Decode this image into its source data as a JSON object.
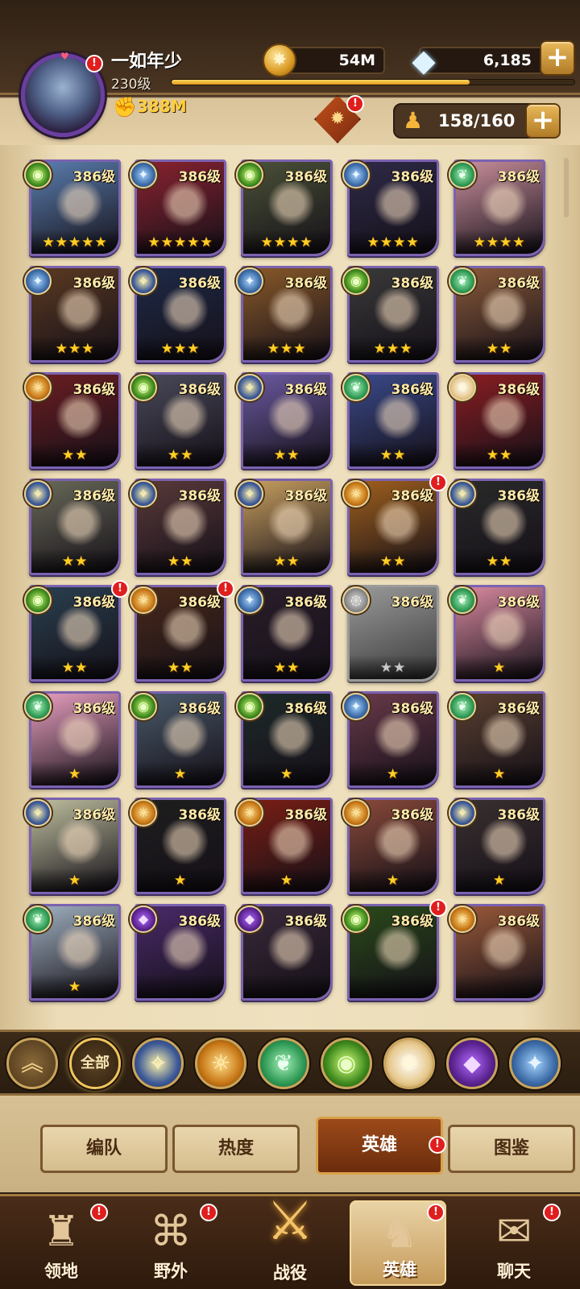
{
  "header": {
    "player_name": "一如年少",
    "player_level": "230级",
    "combat_power": "388M",
    "gold": "54M",
    "gems": "6,185",
    "hero_count": "158/160",
    "exp_progress": 0.74,
    "icons": {
      "avatar": "avatar-portrait",
      "power": "fist-icon",
      "gold": "gold-coin-icon",
      "gem": "diamond-icon",
      "chest": "reward-chest-icon",
      "hero_count": "person-icon",
      "add": "plus-icon"
    }
  },
  "heroes": [
    {
      "level": "386级",
      "stars": "★★★★★",
      "faction": "f-wild",
      "glyph": "◉",
      "color": "#5b7fb0",
      "alert": false,
      "grey": false
    },
    {
      "level": "386级",
      "stars": "★★★★★",
      "faction": "f-tech",
      "glyph": "✦",
      "color": "#8a2330",
      "alert": false,
      "grey": false
    },
    {
      "level": "386级",
      "stars": "★★★★",
      "faction": "f-wild",
      "glyph": "◉",
      "color": "#4a5238",
      "alert": false,
      "grey": false
    },
    {
      "level": "386级",
      "stars": "★★★★",
      "faction": "f-tech",
      "glyph": "✦",
      "color": "#2e2a48",
      "alert": false,
      "grey": false
    },
    {
      "level": "386级",
      "stars": "★★★★",
      "faction": "f-nature",
      "glyph": "❦",
      "color": "#c98f9c",
      "alert": false,
      "grey": false
    },
    {
      "level": "386级",
      "stars": "★★★",
      "faction": "f-tech",
      "glyph": "✦",
      "color": "#5c3a22",
      "alert": false,
      "grey": false
    },
    {
      "level": "386级",
      "stars": "★★★",
      "faction": "f-fort",
      "glyph": "✧",
      "color": "#1e2a48",
      "alert": false,
      "grey": false
    },
    {
      "level": "386级",
      "stars": "★★★",
      "faction": "f-tech",
      "glyph": "✦",
      "color": "#8a5a2a",
      "alert": false,
      "grey": false
    },
    {
      "level": "386级",
      "stars": "★★★",
      "faction": "f-wild",
      "glyph": "◉",
      "color": "#3a3a3a",
      "alert": false,
      "grey": false
    },
    {
      "level": "386级",
      "stars": "★★",
      "faction": "f-nature",
      "glyph": "❦",
      "color": "#8a5a3a",
      "alert": false,
      "grey": false
    },
    {
      "level": "386级",
      "stars": "★★",
      "faction": "f-force",
      "glyph": "☼",
      "color": "#6b1e22",
      "alert": false,
      "grey": false
    },
    {
      "level": "386级",
      "stars": "★★",
      "faction": "f-wild",
      "glyph": "◉",
      "color": "#4a4a5a",
      "alert": false,
      "grey": false
    },
    {
      "level": "386级",
      "stars": "★★",
      "faction": "f-fort",
      "glyph": "✧",
      "color": "#6b5aa0",
      "alert": false,
      "grey": false
    },
    {
      "level": "386级",
      "stars": "★★",
      "faction": "f-nature",
      "glyph": "❦",
      "color": "#3a4a8a",
      "alert": false,
      "grey": false
    },
    {
      "level": "386级",
      "stars": "★★",
      "faction": "f-light",
      "glyph": "✺",
      "color": "#8a1e22",
      "alert": false,
      "grey": false
    },
    {
      "level": "386级",
      "stars": "★★",
      "faction": "f-fort",
      "glyph": "✧",
      "color": "#6a6a5a",
      "alert": false,
      "grey": false
    },
    {
      "level": "386级",
      "stars": "★★",
      "faction": "f-fort",
      "glyph": "✧",
      "color": "#5a3a3a",
      "alert": false,
      "grey": false
    },
    {
      "level": "386级",
      "stars": "★★",
      "faction": "f-fort",
      "glyph": "✧",
      "color": "#c9a060",
      "alert": false,
      "grey": false
    },
    {
      "level": "386级",
      "stars": "★★",
      "faction": "f-force",
      "glyph": "☼",
      "color": "#a0601e",
      "alert": true,
      "grey": false
    },
    {
      "level": "386级",
      "stars": "★★",
      "faction": "f-fort",
      "glyph": "✧",
      "color": "#2a2a2a",
      "alert": false,
      "grey": false
    },
    {
      "level": "386级",
      "stars": "★★",
      "faction": "f-wild",
      "glyph": "◉",
      "color": "#2a4050",
      "alert": true,
      "grey": false
    },
    {
      "level": "386级",
      "stars": "★★",
      "faction": "f-force",
      "glyph": "☼",
      "color": "#4a2a1a",
      "alert": true,
      "grey": false
    },
    {
      "level": "386级",
      "stars": "★★",
      "faction": "f-tech",
      "glyph": "✦",
      "color": "#2a1e2a",
      "alert": false,
      "grey": false
    },
    {
      "level": "386级",
      "stars": "★★",
      "faction": "f-none",
      "glyph": "◌",
      "color": "#5a5a5a",
      "alert": false,
      "grey": true
    },
    {
      "level": "386级",
      "stars": "★",
      "faction": "f-nature",
      "glyph": "❦",
      "color": "#d98aa0",
      "alert": false,
      "grey": false
    },
    {
      "level": "386级",
      "stars": "★",
      "faction": "f-nature",
      "glyph": "❦",
      "color": "#e9a0c0",
      "alert": false,
      "grey": false
    },
    {
      "level": "386级",
      "stars": "★",
      "faction": "f-wild",
      "glyph": "◉",
      "color": "#4a5a6a",
      "alert": false,
      "grey": false
    },
    {
      "level": "386级",
      "stars": "★",
      "faction": "f-wild",
      "glyph": "◉",
      "color": "#1e2a2a",
      "alert": false,
      "grey": false
    },
    {
      "level": "386级",
      "stars": "★",
      "faction": "f-tech",
      "glyph": "✦",
      "color": "#6a3a4a",
      "alert": false,
      "grey": false
    },
    {
      "level": "386级",
      "stars": "★",
      "faction": "f-nature",
      "glyph": "❦",
      "color": "#5a4030",
      "alert": false,
      "grey": false
    },
    {
      "level": "386级",
      "stars": "★",
      "faction": "f-fort",
      "glyph": "✧",
      "color": "#c0c0a0",
      "alert": false,
      "grey": false
    },
    {
      "level": "386级",
      "stars": "★",
      "faction": "f-force",
      "glyph": "☼",
      "color": "#1e1e1e",
      "alert": false,
      "grey": false
    },
    {
      "level": "386级",
      "stars": "★",
      "faction": "f-force",
      "glyph": "☼",
      "color": "#7a1e14",
      "alert": false,
      "grey": false
    },
    {
      "level": "386级",
      "stars": "★",
      "faction": "f-force",
      "glyph": "☼",
      "color": "#8a4a3a",
      "alert": false,
      "grey": false
    },
    {
      "level": "386级",
      "stars": "★",
      "faction": "f-fort",
      "glyph": "✧",
      "color": "#3a3030",
      "alert": false,
      "grey": false
    },
    {
      "level": "386级",
      "stars": "★",
      "faction": "f-nature",
      "glyph": "❦",
      "color": "#a0b0c0",
      "alert": false,
      "grey": false
    },
    {
      "level": "386级",
      "stars": "",
      "faction": "f-dark",
      "glyph": "◆",
      "color": "#4a2a6a",
      "alert": false,
      "grey": false
    },
    {
      "level": "386级",
      "stars": "",
      "faction": "f-dark",
      "glyph": "◆",
      "color": "#3a2a3a",
      "alert": false,
      "grey": false
    },
    {
      "level": "386级",
      "stars": "",
      "faction": "f-wild",
      "glyph": "◉",
      "color": "#2a4a1a",
      "alert": true,
      "grey": false
    },
    {
      "level": "386级",
      "stars": "",
      "faction": "f-force",
      "glyph": "☼",
      "color": "#9a5a3a",
      "alert": false,
      "grey": false
    }
  ],
  "filters": [
    {
      "label": "",
      "faction": "filter-collapse",
      "glyph": "︽",
      "name": "collapse-filter-button"
    },
    {
      "label": "全部",
      "faction": "filter-all",
      "glyph": "",
      "name": "filter-all-button"
    },
    {
      "label": "",
      "faction": "f-fort",
      "glyph": "✧",
      "name": "filter-lightbearer-button"
    },
    {
      "label": "",
      "faction": "f-force",
      "glyph": "☼",
      "name": "filter-graveborn-button"
    },
    {
      "label": "",
      "faction": "f-nature",
      "glyph": "❦",
      "name": "filter-wilder-button"
    },
    {
      "label": "",
      "faction": "f-wild",
      "glyph": "◉",
      "name": "filter-maulers-button"
    },
    {
      "label": "",
      "faction": "f-light",
      "glyph": "✺",
      "name": "filter-celestial-button"
    },
    {
      "label": "",
      "faction": "f-dark",
      "glyph": "◆",
      "name": "filter-hypogean-button"
    },
    {
      "label": "",
      "faction": "f-tech",
      "glyph": "✦",
      "name": "filter-dimensional-button"
    }
  ],
  "tabs": [
    {
      "label": "编队",
      "active": false
    },
    {
      "label": "热度",
      "active": false
    },
    {
      "label": "英雄",
      "active": true
    },
    {
      "label": "图鉴",
      "active": false
    }
  ],
  "nav": [
    {
      "label": "领地",
      "icon": "castle-icon",
      "glyph": "♜",
      "active": false,
      "alert": true
    },
    {
      "label": "野外",
      "icon": "map-scroll-icon",
      "glyph": "⌘",
      "active": false,
      "alert": true
    },
    {
      "label": "战役",
      "icon": "battle-crest-icon",
      "glyph": "⚔",
      "active": false,
      "alert": false
    },
    {
      "label": "英雄",
      "icon": "helmet-icon",
      "glyph": "♞",
      "active": true,
      "alert": true
    },
    {
      "label": "聊天",
      "icon": "chat-bubble-icon",
      "glyph": "✉",
      "active": false,
      "alert": true
    }
  ],
  "alert_glyph": "!"
}
